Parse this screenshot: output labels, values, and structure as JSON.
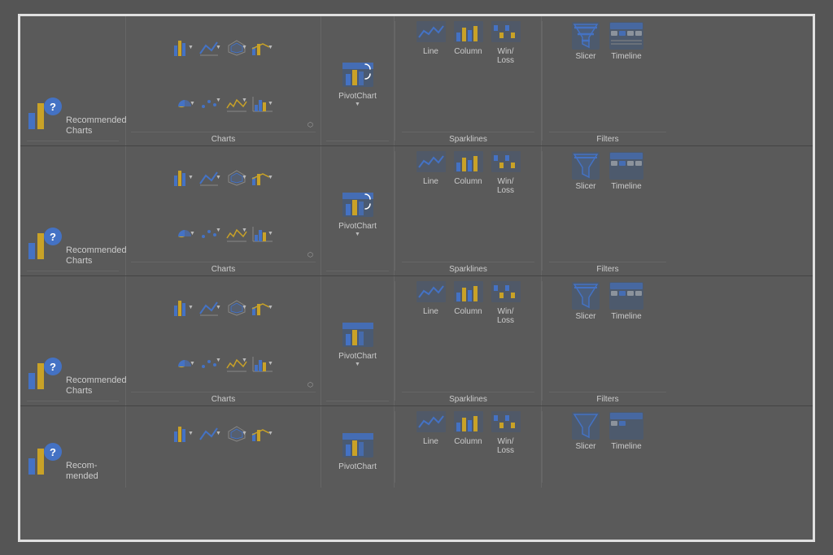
{
  "rows": [
    {
      "id": 1
    },
    {
      "id": 2
    },
    {
      "id": 3
    },
    {
      "id": 4
    }
  ],
  "sections": {
    "recommended_charts": {
      "label": "Recommended\nCharts"
    },
    "charts": {
      "label": "Charts",
      "expand_label": "⬡"
    },
    "pivot_chart": {
      "label": "PivotChart",
      "dropdown": "▼"
    },
    "sparklines": {
      "label": "Sparklines",
      "items": [
        {
          "label": "Line"
        },
        {
          "label": "Column"
        },
        {
          "label": "Win/\nLoss"
        }
      ]
    },
    "filters": {
      "label": "Filters",
      "items": [
        {
          "label": "Slicer"
        },
        {
          "label": "Timeline"
        }
      ]
    }
  }
}
